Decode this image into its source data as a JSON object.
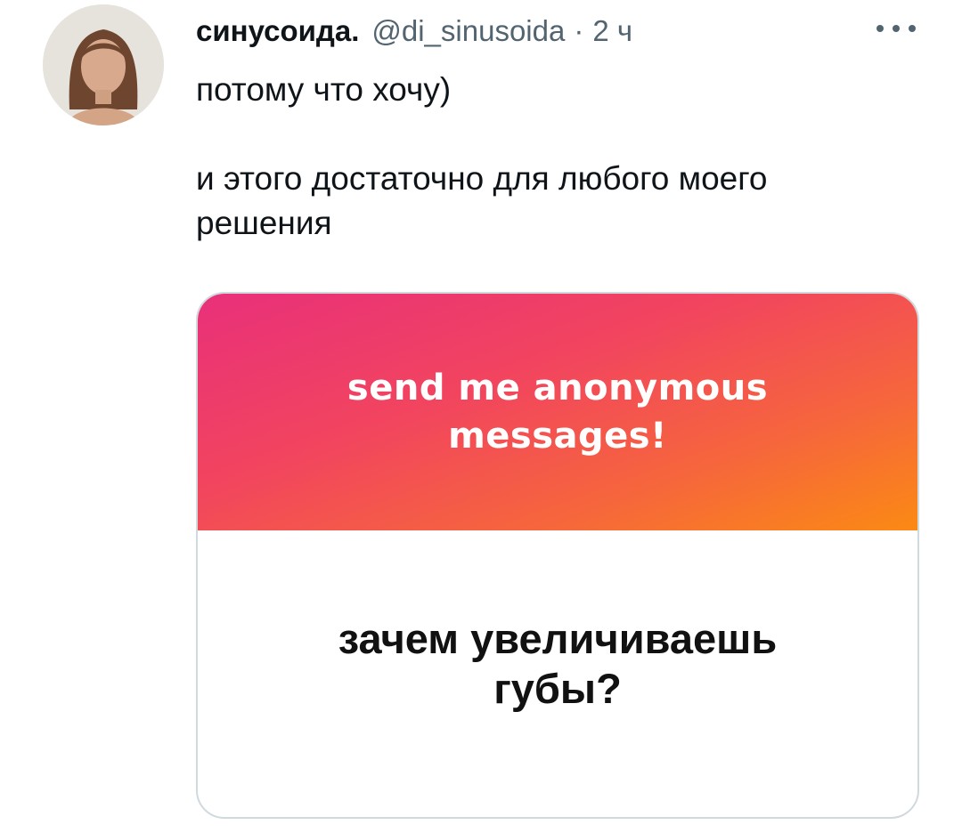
{
  "tweet": {
    "author": {
      "display_name": "синусоида.",
      "handle": "@di_sinusoida",
      "avatar_alt": "profile photo"
    },
    "separator": "·",
    "time": "2 ч",
    "text": {
      "line1": "потому что хочу)",
      "line2": "и этого достаточно для любого моего",
      "line3": "решения"
    },
    "media": {
      "promo_line1": "send me anonymous",
      "promo_line2": "messages!",
      "question_line1": "зачем увеличиваешь",
      "question_line2": "губы?",
      "gradient_colors": [
        "#e8307a",
        "#f2455e",
        "#f6663c",
        "#fb8a14"
      ]
    }
  },
  "icons": {
    "more": "more-horizontal-icon"
  }
}
